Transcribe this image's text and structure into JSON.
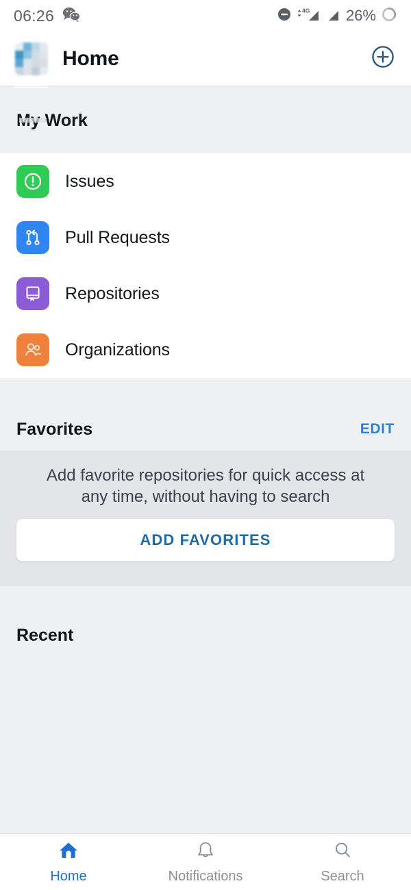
{
  "status_bar": {
    "time": "06:26",
    "app_icon": "wechat-icon",
    "icons": [
      "do-not-disturb-icon",
      "signal-4g-icon",
      "signal-bars-icon"
    ],
    "battery_percent": "26%",
    "battery_icon": "battery-ring-icon"
  },
  "header": {
    "title": "Home",
    "avatar": {
      "name": "user-avatar",
      "tiles": [
        "#e8eef4",
        "#6fb4dc",
        "#bcd7e8",
        "#e3e8ee",
        "#3f93c4",
        "#8fc5e0",
        "#cfdde8",
        "#dfe4ea",
        "#5aa7d4",
        "#d9e6f0",
        "#d4dbe3",
        "#dadfe6",
        "#c7d4e0",
        "#dbe2ea",
        "#c3ccd6",
        "#e6eaf0"
      ]
    },
    "add_button": "add-icon"
  },
  "sections": {
    "my_work": {
      "title": "My Work",
      "items": [
        {
          "label": "Issues",
          "icon": "issue-opened-icon",
          "color": "#2ecc55"
        },
        {
          "label": "Pull Requests",
          "icon": "git-pull-request-icon",
          "color": "#2f86f2"
        },
        {
          "label": "Repositories",
          "icon": "repo-icon",
          "color": "#8b5cd6"
        },
        {
          "label": "Organizations",
          "icon": "organization-icon",
          "color": "#f0813c"
        }
      ]
    },
    "favorites": {
      "title": "Favorites",
      "edit_label": "EDIT",
      "empty_text": "Add favorite repositories for quick access at any time, without having to search",
      "add_button_label": "ADD FAVORITES"
    },
    "recent": {
      "title": "Recent"
    }
  },
  "bottom_nav": {
    "items": [
      {
        "label": "Home",
        "icon": "home-icon",
        "active": true
      },
      {
        "label": "Notifications",
        "icon": "bell-icon",
        "active": false
      },
      {
        "label": "Search",
        "icon": "search-icon",
        "active": false
      }
    ]
  },
  "colors": {
    "accent_blue": "#1f6fd0",
    "link_blue": "#2f81d6",
    "page_bg": "#eef0f3",
    "panel_bg": "#e3e5e9"
  }
}
